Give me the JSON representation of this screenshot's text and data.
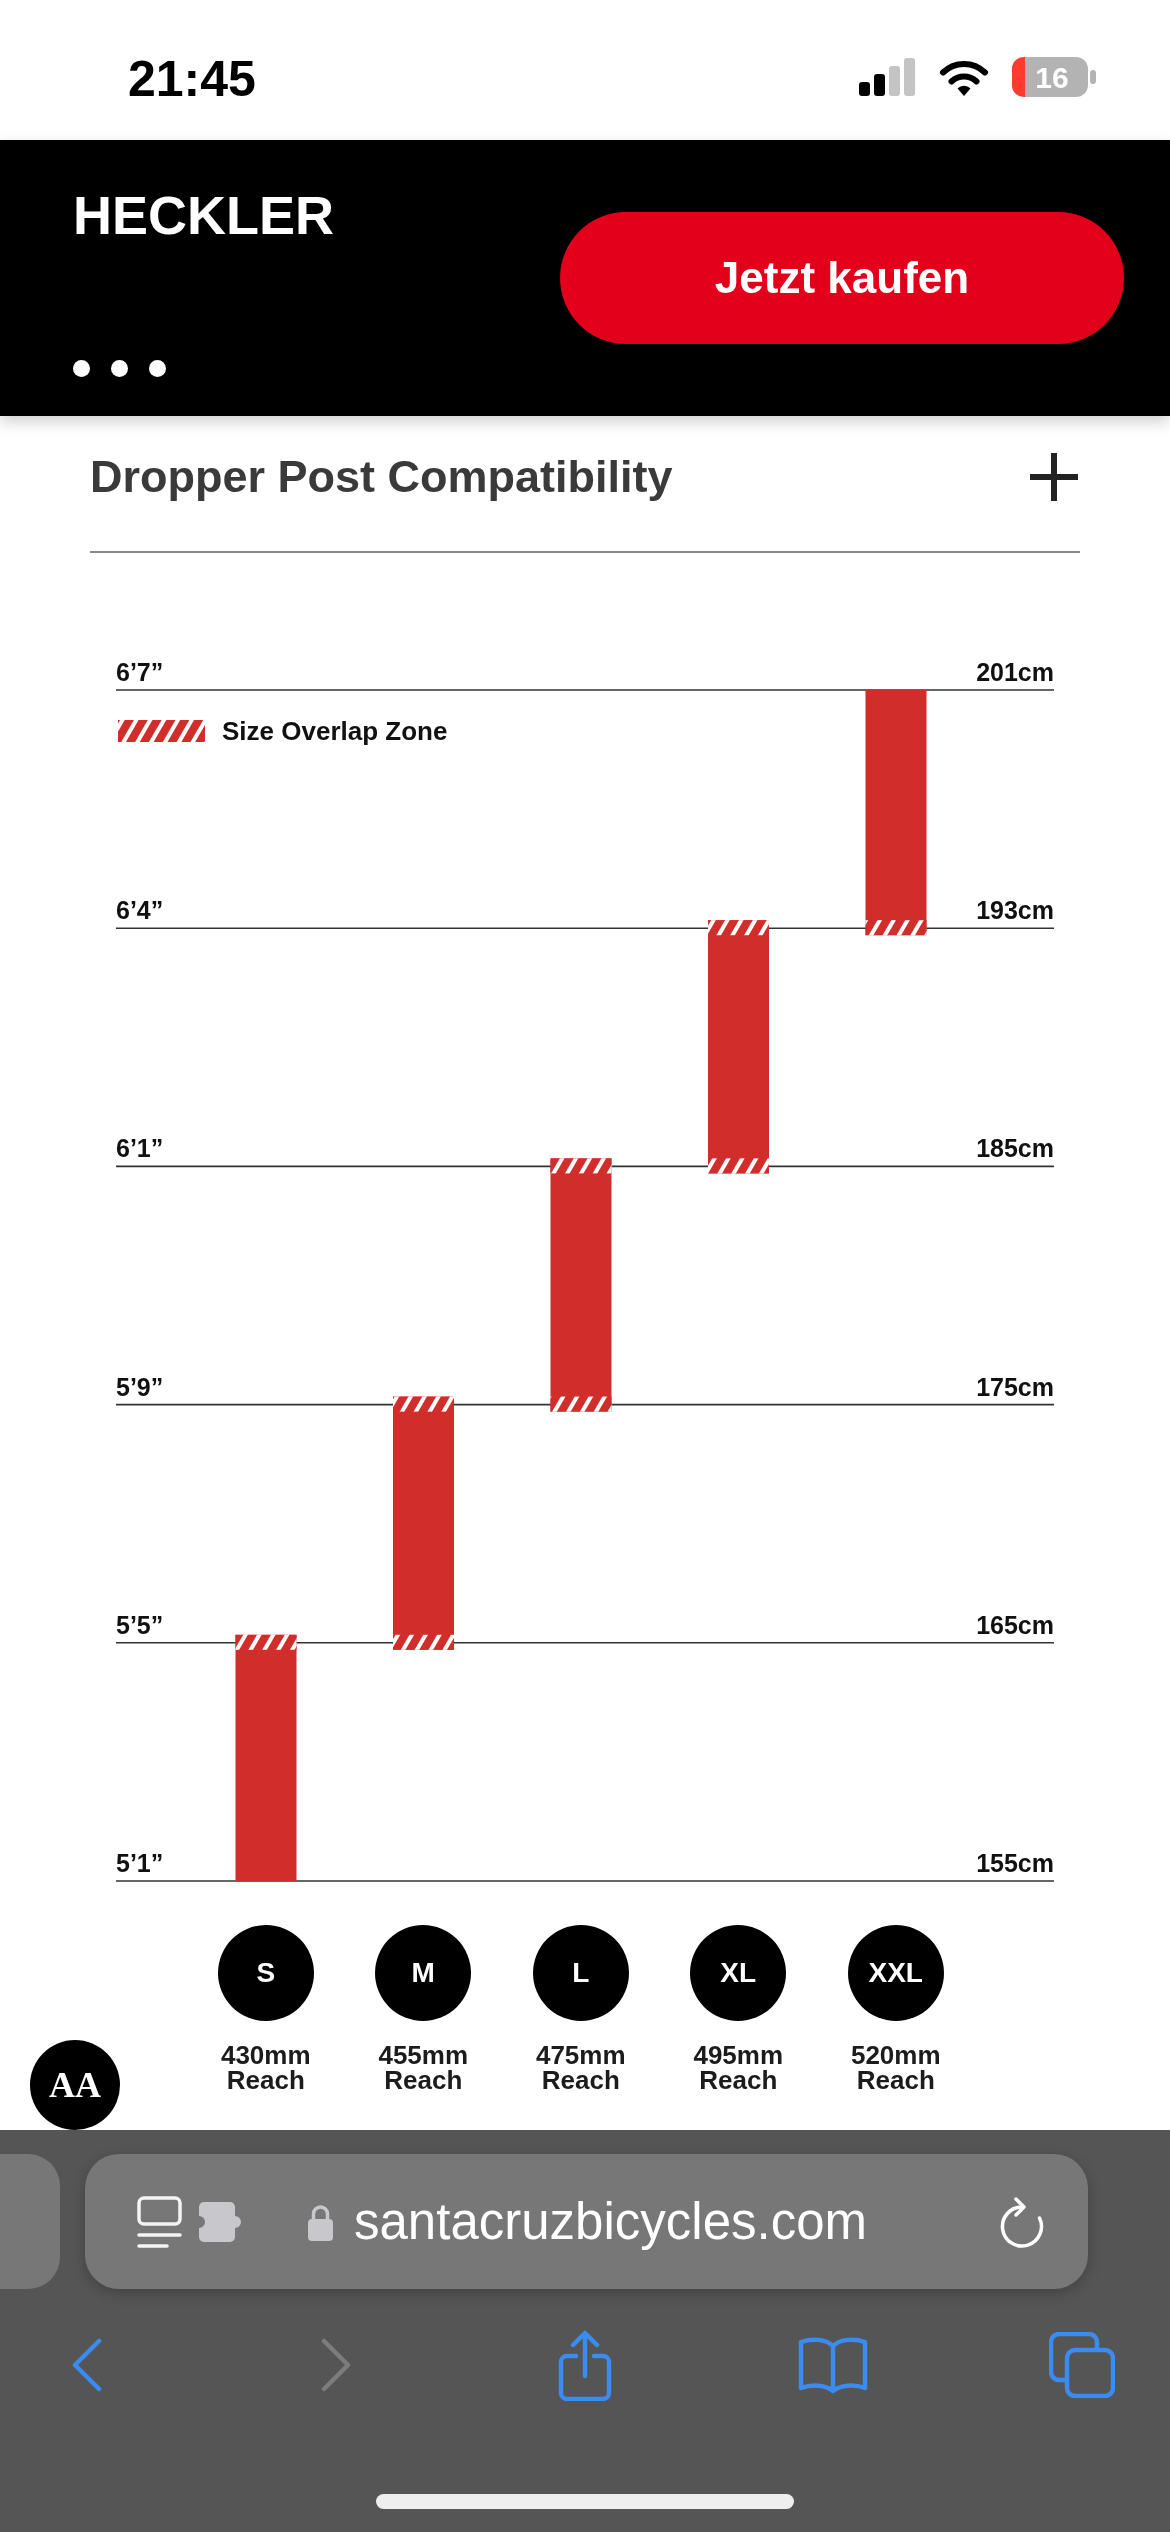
{
  "status_bar": {
    "time": "21:45",
    "battery": "16"
  },
  "header": {
    "title": "HECKLER",
    "buy_button": "Jetzt kaufen"
  },
  "accordion": {
    "title": "Dropper Post Compatibility",
    "expanded": false
  },
  "size_chart": {
    "legend": "Size Overlap Zone",
    "height_lines": [
      {
        "imperial": "6’7”",
        "metric": "201cm"
      },
      {
        "imperial": "6’4”",
        "metric": "193cm"
      },
      {
        "imperial": "6’1”",
        "metric": "185cm"
      },
      {
        "imperial": "5’9”",
        "metric": "175cm"
      },
      {
        "imperial": "5’5”",
        "metric": "165cm"
      },
      {
        "imperial": "5’1”",
        "metric": "155cm"
      }
    ],
    "sizes": [
      {
        "label": "S",
        "reach": "430mm Reach",
        "overlap_above": true,
        "overlap_below": false
      },
      {
        "label": "M",
        "reach": "455mm Reach",
        "overlap_above": true,
        "overlap_below": true
      },
      {
        "label": "L",
        "reach": "475mm Reach",
        "overlap_above": true,
        "overlap_below": true
      },
      {
        "label": "XL",
        "reach": "495mm Reach",
        "overlap_above": true,
        "overlap_below": true
      },
      {
        "label": "XXL",
        "reach": "520mm Reach",
        "overlap_above": false,
        "overlap_below": true
      }
    ]
  },
  "text_size_button": {
    "label": "AA"
  },
  "browser": {
    "url": "santacruzbicycles.com",
    "toolbar": [
      {
        "kind": "back",
        "disabled": false
      },
      {
        "kind": "forward",
        "disabled": true
      },
      {
        "kind": "share",
        "disabled": false
      },
      {
        "kind": "bookmarks",
        "disabled": false
      },
      {
        "kind": "tabs",
        "disabled": false
      }
    ]
  }
}
